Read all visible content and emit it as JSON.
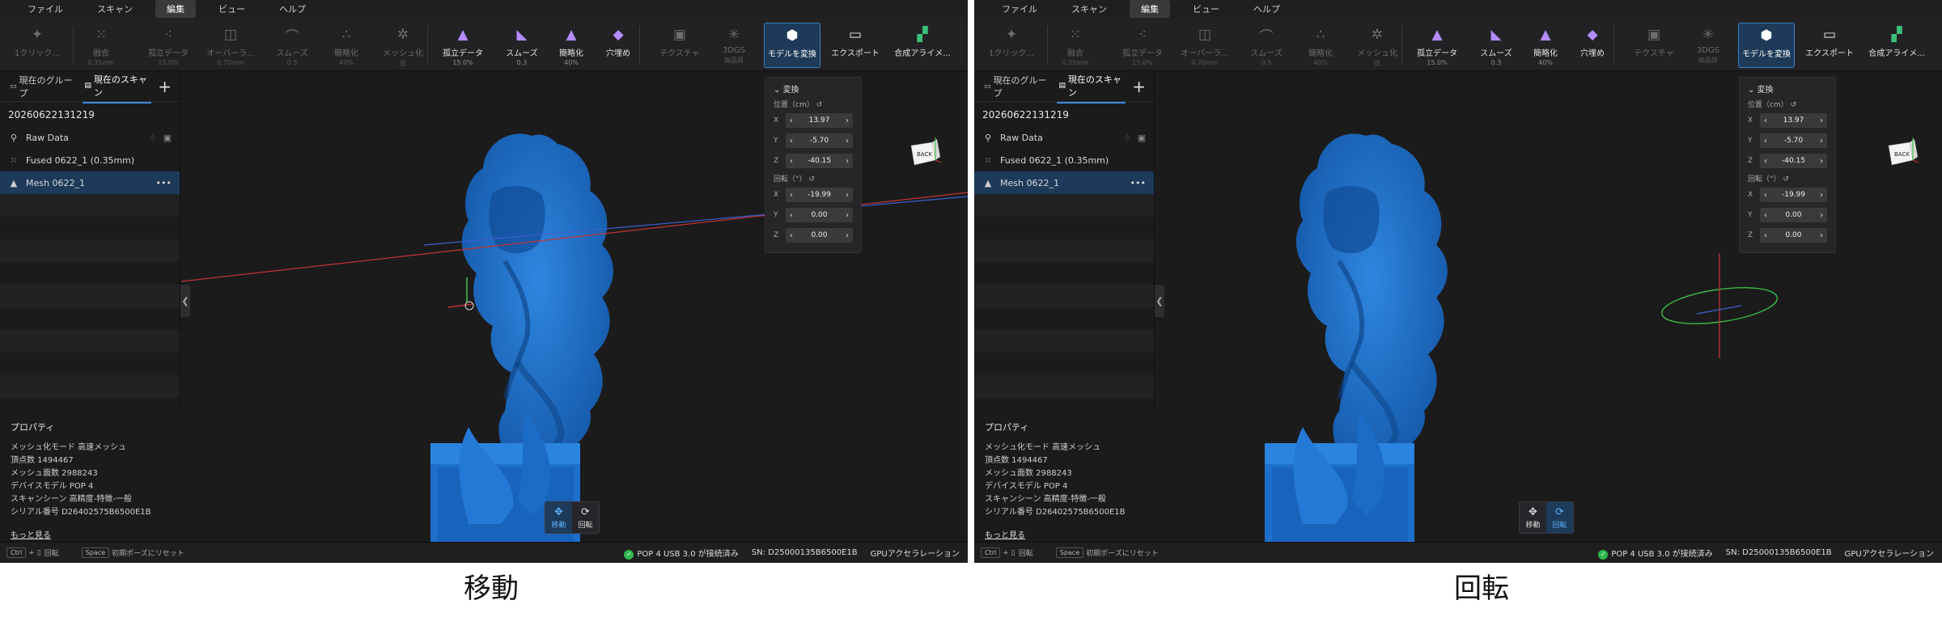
{
  "menu": [
    "ファイル",
    "スキャン",
    "編集",
    "ビュー",
    "ヘルプ"
  ],
  "menu_active": 2,
  "toolbar": [
    {
      "label": "1クリック...",
      "sub": "",
      "icon": "magic-wand-icon",
      "enabled": false
    },
    {
      "label": "融合",
      "sub": "0.35mm",
      "icon": "fusion-icon",
      "enabled": false
    },
    {
      "label": "孤立データ",
      "sub": "15.0%",
      "icon": "isolate-icon",
      "enabled": false
    },
    {
      "label": "オーバーラ...",
      "sub": "0.70mm",
      "icon": "overlap-icon",
      "enabled": false
    },
    {
      "label": "スムーズ",
      "sub": "0.5",
      "icon": "smooth-icon",
      "enabled": false
    },
    {
      "label": "簡略化",
      "sub": "40%",
      "icon": "simplify-icon",
      "enabled": false
    },
    {
      "label": "メッシュ化",
      "sub": "低",
      "icon": "mesh-icon",
      "enabled": false
    },
    {
      "label": "孤立データ",
      "sub": "15.0%",
      "icon": "isolate-mesh-icon",
      "enabled": true
    },
    {
      "label": "スムーズ",
      "sub": "0.3",
      "icon": "smooth-mesh-icon",
      "enabled": true
    },
    {
      "label": "簡略化",
      "sub": "40%",
      "icon": "simplify-mesh-icon",
      "enabled": true
    },
    {
      "label": "穴埋め",
      "sub": "",
      "icon": "hole-fill-icon",
      "enabled": true
    },
    {
      "label": "テクスチャ",
      "sub": "",
      "icon": "texture-icon",
      "enabled": false
    },
    {
      "label": "3DGS",
      "sub": "高品質",
      "icon": "gaussian-icon",
      "enabled": false
    },
    {
      "label": "モデルを変換",
      "sub": "",
      "icon": "transform-model-icon",
      "enabled": true,
      "selected": true
    },
    {
      "label": "エクスポート",
      "sub": "",
      "icon": "export-icon",
      "enabled": true
    },
    {
      "label": "合成アライメ...",
      "sub": "",
      "icon": "align-icon",
      "enabled": true
    }
  ],
  "tabs": [
    "現在のグループ",
    "現在のスキャン"
  ],
  "scan_name": "20260622131219",
  "items": [
    {
      "label": "Raw Data",
      "icon": "raw-data-icon"
    },
    {
      "label": "Fused 0622_1 (0.35mm)",
      "icon": "fused-points-icon"
    },
    {
      "label": "Mesh 0622_1",
      "icon": "mesh-item-icon"
    }
  ],
  "more_icon": "more-icon",
  "properties": {
    "title": "プロパティ",
    "lines": [
      "メッシュ化モード 高速メッシュ",
      "頂点数 1494467",
      "メッシュ面数 2988243",
      "デバイスモデル POP 4",
      "スキャンシーン 高精度-特徴-一般",
      "シリアル番号 D26402575B6500E1B"
    ],
    "more": "もっと見る"
  },
  "transform": {
    "header": "変換",
    "position": "位置（cm）",
    "rotation": "回転（°）",
    "pos": [
      {
        "axis": "X",
        "value": "13.97"
      },
      {
        "axis": "Y",
        "value": "-5.70"
      },
      {
        "axis": "Z",
        "value": "-40.15"
      }
    ],
    "rot": [
      {
        "axis": "X",
        "value": "-19.99"
      },
      {
        "axis": "Y",
        "value": "0.00"
      },
      {
        "axis": "Z",
        "value": "0.00"
      }
    ]
  },
  "cube_label": "BACK",
  "mode_tools": [
    {
      "label": "移動",
      "icon": "move-icon"
    },
    {
      "label": "回転",
      "icon": "rotate-icon"
    }
  ],
  "status": {
    "ctrl_key": "Ctrl",
    "plus": "+",
    "rotate_hint": "回転",
    "space_key": "Space",
    "reset_hint": "初期ポーズにリセット",
    "connection": "POP 4 USB 3.0 が接続済み",
    "sn": "SN: D25000135B6500E1B",
    "gpu": "GPUアクセラレーション"
  },
  "panels": [
    {
      "caption": "移動",
      "active_tool": 0
    },
    {
      "caption": "回転",
      "active_tool": 1
    }
  ],
  "colors": {
    "accent": "#3d8ee0",
    "model": "#1f6fc6",
    "connected": "#2fb84d"
  }
}
